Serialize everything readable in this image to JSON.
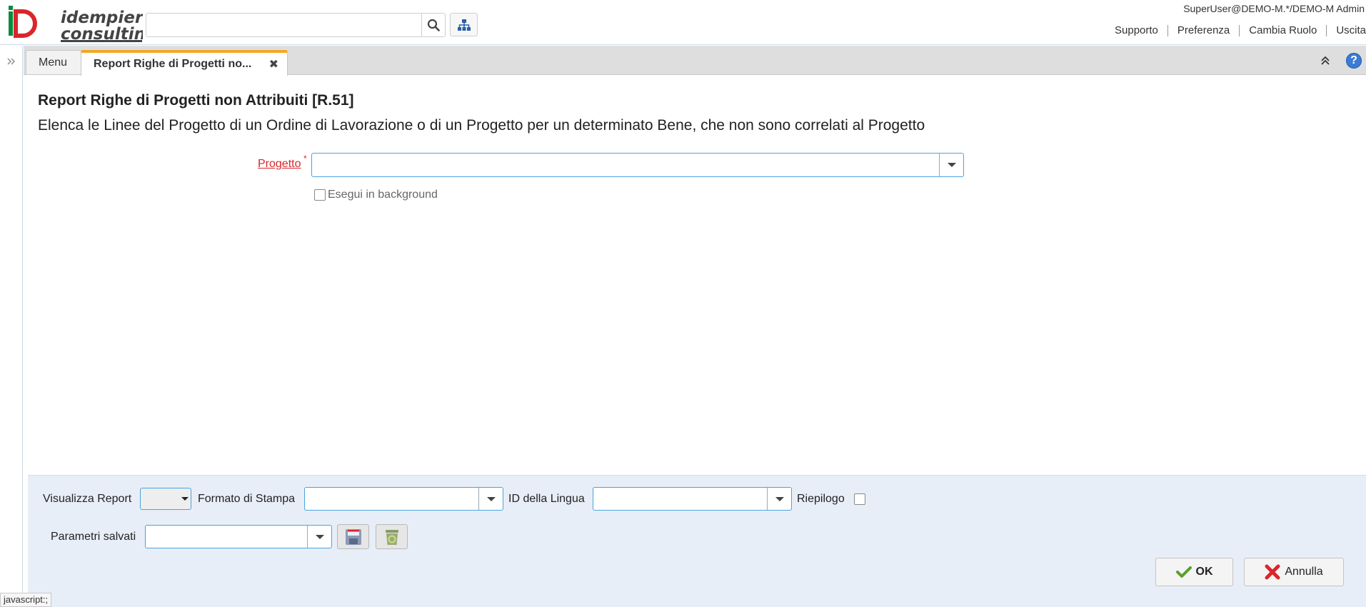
{
  "header": {
    "logo_text_line1": "idempiere",
    "logo_text_line2": "consulting",
    "search_placeholder": "",
    "user": "SuperUser@DEMO-M.*/DEMO-M Admin",
    "links": [
      "Supporto",
      "Preferenza",
      "Cambia Ruolo",
      "Uscita"
    ]
  },
  "tabs": {
    "menu_label": "Menu",
    "active_label": "Report Righe di Progetti no...",
    "close_glyph": "✖",
    "help_glyph": "?"
  },
  "content": {
    "title": "Report Righe di Progetti non Attribuiti [R.51]",
    "description": "Elenca le Linee del Progetto di un Ordine di Lavorazione o di un Progetto per un determinato Bene, che non sono correlati al Progetto",
    "project_label": "Progetto",
    "required_marker": "*",
    "project_value": "",
    "background_label": "Esegui in background",
    "background_checked": false
  },
  "bottom": {
    "view_report_label": "Visualizza Report",
    "print_format_label": "Formato di Stampa",
    "print_format_value": "",
    "language_label": "ID della Lingua",
    "language_value": "",
    "summary_label": "Riepilogo",
    "summary_checked": false,
    "saved_params_label": "Parametri salvati",
    "saved_params_value": "",
    "ok_label": "OK",
    "cancel_label": "Annulla"
  },
  "status_hint": "javascript:;",
  "colors": {
    "accent_tab": "#f5a623",
    "required": "#d9262b",
    "field_border": "#4aa3df",
    "panel_bg": "#e8eef8",
    "ok_check": "#5aa02c",
    "cancel_x": "#d9262b"
  }
}
